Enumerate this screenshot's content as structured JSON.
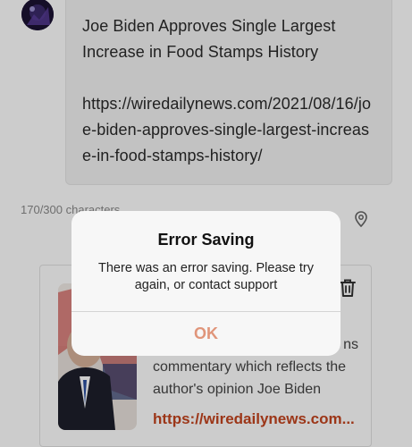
{
  "composer": {
    "title_line": "Joe Biden Approves Single Largest Increase in Food Stamps History",
    "url": "https://wiredailynews.com/2021/08/16/joe-biden-approves-single-largest-increase-in-food-stamps-history/"
  },
  "char_count": "170/300 characters",
  "preview": {
    "description_partial": "ns",
    "description": "commentary which reflects the author's opinion Joe Biden",
    "link": "https://wiredailynews.com..."
  },
  "dialog": {
    "title": "Error Saving",
    "message": "There was an error saving. Please try again, or contact support",
    "ok_label": "OK"
  },
  "colors": {
    "accent": "#c4441e",
    "ok_button": "#e0957a",
    "overlay": "rgba(0,0,0,0.2)"
  },
  "icons": {
    "location": "map-pin-icon",
    "delete": "trash-icon"
  }
}
